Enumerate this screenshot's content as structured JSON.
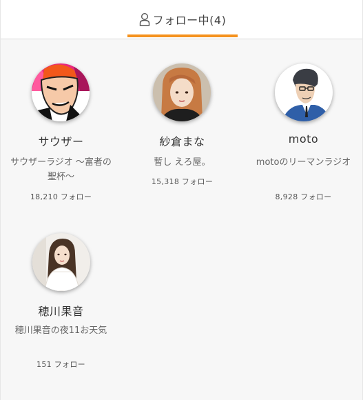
{
  "tabs": [
    {
      "label": "フォロー中(4)",
      "icon": "person-icon",
      "active": true
    }
  ],
  "accent_color": "#f5921e",
  "follows": [
    {
      "name": "サウザー",
      "program": "サウザーラジオ 〜富者の聖杯〜",
      "followers": "18,210 フォロー",
      "avatar": "comic-character-avatar"
    },
    {
      "name": "紗倉まな",
      "program": "暫し えろ屋。",
      "followers": "15,318 フォロー",
      "avatar": "woman-photo-avatar"
    },
    {
      "name": "moto",
      "program": "motoのリーマンラジオ",
      "followers": "8,928 フォロー",
      "avatar": "illustrated-man-avatar"
    },
    {
      "name": "穂川果音",
      "program": "穂川果音の夜11お天気",
      "followers": "151 フォロー",
      "avatar": "woman-white-dress-avatar"
    }
  ]
}
